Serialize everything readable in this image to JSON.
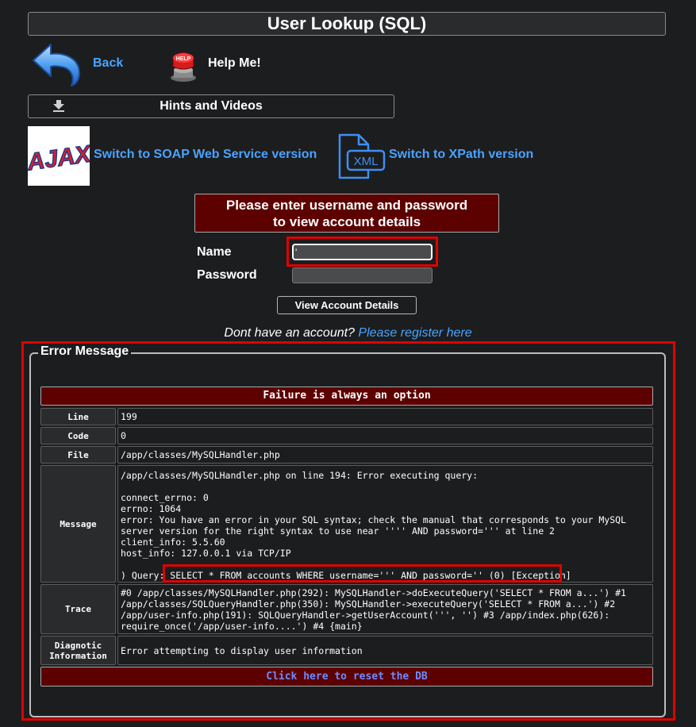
{
  "page": {
    "title": "User Lookup (SQL)"
  },
  "nav": {
    "back_label": "Back",
    "help_label": "Help Me!",
    "help_icon_text": "HELP"
  },
  "hints": {
    "label": "Hints and Videos"
  },
  "switches": {
    "ajax_logo_text": "AJAX",
    "soap_label": "Switch to SOAP Web Service version",
    "xml_icon_text": "XML",
    "xpath_label": "Switch to XPath version"
  },
  "login": {
    "header_line1": "Please enter username and password",
    "header_line2": "to view account details",
    "name_label": "Name",
    "name_value": "'",
    "password_label": "Password",
    "password_value": "",
    "submit_label": "View Account Details",
    "register_prompt": "Dont have an account?",
    "register_link": "Please register here"
  },
  "error": {
    "legend": "Error Message",
    "banner": "Failure is always an option",
    "rows": {
      "line": {
        "label": "Line",
        "value": "199"
      },
      "code": {
        "label": "Code",
        "value": "0"
      },
      "file": {
        "label": "File",
        "value": "/app/classes/MySQLHandler.php"
      },
      "message": {
        "label": "Message",
        "value": "/app/classes/MySQLHandler.php on line 194: Error executing query:\n\nconnect_errno: 0\nerrno: 1064\nerror: You have an error in your SQL syntax; check the manual that corresponds to your MySQL server version for the right syntax to use near '''' AND password=''' at line 2\nclient_info: 5.5.60\nhost_info: 127.0.0.1 via TCP/IP\n\n) Query: SELECT * FROM accounts WHERE username=''' AND password='' (0) [Exception]"
      },
      "trace": {
        "label": "Trace",
        "value": "#0 /app/classes/MySQLHandler.php(292): MySQLHandler->doExecuteQuery('SELECT * FROM a...') #1 /app/classes/SQLQueryHandler.php(350): MySQLHandler->executeQuery('SELECT * FROM a...') #2 /app/user-info.php(191): SQLQueryHandler->getUserAccount(''', '') #3 /app/index.php(626): require_once('/app/user-info....') #4 {main}"
      },
      "diagnostic": {
        "label": "Diagnotic Information",
        "value": "Error attempting to display user information"
      }
    },
    "reset_label": "Click here to reset the DB"
  },
  "colors": {
    "background": "#1c1d1f",
    "link": "#4aa3ff",
    "banner": "#5c0000",
    "highlight": "#e10000"
  }
}
